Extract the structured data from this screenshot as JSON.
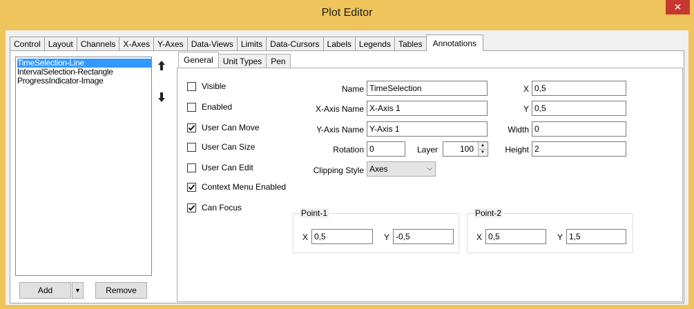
{
  "window": {
    "title": "Plot Editor",
    "close_glyph": "✕"
  },
  "tabs": [
    "Control",
    "Layout",
    "Channels",
    "X-Axes",
    "Y-Axes",
    "Data-Views",
    "Limits",
    "Data-Cursors",
    "Labels",
    "Legends",
    "Tables",
    "Annotations"
  ],
  "active_tab": "Annotations",
  "annotations_list": [
    "TimeSelection-Line",
    "IntervalSelection-Rectangle",
    "ProgressIndicator-Image"
  ],
  "selected_annotation": "TimeSelection-Line",
  "list_buttons": {
    "add": "Add",
    "dropdown_glyph": "▼",
    "remove": "Remove",
    "up_icon": "arrow-up-icon",
    "down_icon": "arrow-down-icon"
  },
  "inner_tabs": [
    "General",
    "Unit Types",
    "Pen"
  ],
  "active_inner_tab": "General",
  "checkboxes": [
    {
      "label": "Visible",
      "checked": false
    },
    {
      "label": "Enabled",
      "checked": false
    },
    {
      "label": "User Can Move",
      "checked": true
    },
    {
      "label": "User Can Size",
      "checked": false
    },
    {
      "label": "User Can Edit",
      "checked": false
    },
    {
      "label": "Context Menu Enabled",
      "checked": true
    },
    {
      "label": "Can Focus",
      "checked": true
    }
  ],
  "form": {
    "name_label": "Name",
    "name_value": "TimeSelection",
    "xaxis_label": "X-Axis Name",
    "xaxis_value": "X-Axis 1",
    "yaxis_label": "Y-Axis Name",
    "yaxis_value": "Y-Axis 1",
    "rotation_label": "Rotation",
    "rotation_value": "0",
    "layer_label": "Layer",
    "layer_value": "100",
    "clipping_label": "Clipping Style",
    "clipping_value": "Axes",
    "x_label": "X",
    "x_value": "0,5",
    "y_label": "Y",
    "y_value": "0,5",
    "width_label": "Width",
    "width_value": "0",
    "height_label": "Height",
    "height_value": "2"
  },
  "point1": {
    "title": "Point-1",
    "x_label": "X",
    "x_value": "0,5",
    "y_label": "Y",
    "y_value": "-0,5"
  },
  "point2": {
    "title": "Point-2",
    "x_label": "X",
    "x_value": "0,5",
    "y_label": "Y",
    "y_value": "1,5"
  },
  "colors": {
    "titlebar": "#f0c45c",
    "close": "#c7372f",
    "selection": "#3399ff"
  }
}
